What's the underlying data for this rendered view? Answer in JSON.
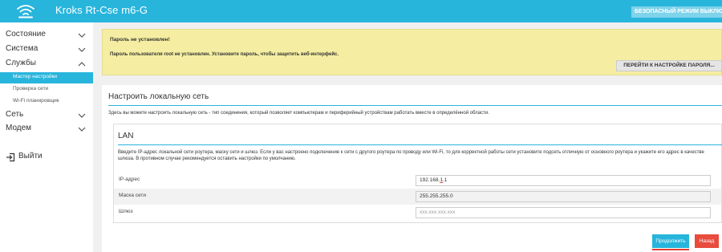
{
  "header": {
    "title": "Kroks Rt-Cse m6-G",
    "safe_mode_button": "БЕЗОПАСНЫЙ РЕЖИМ ВЫКЛЮЧЕН",
    "logo_icon": "wifi-icon",
    "accent_color": "#28b5dc"
  },
  "sidebar": {
    "items": [
      {
        "label": "Состояние",
        "icon": "chevron-down-icon"
      },
      {
        "label": "Система",
        "icon": "chevron-down-icon"
      },
      {
        "label": "Службы",
        "icon": "chevron-up-icon"
      },
      {
        "label": "Сеть",
        "icon": "chevron-down-icon"
      },
      {
        "label": "Модем",
        "icon": "chevron-down-icon"
      }
    ],
    "subitems": [
      {
        "label": "Мастер настройки",
        "active": true
      },
      {
        "label": "Проверка сети",
        "active": false
      },
      {
        "label": "Wi-Fi планировщик",
        "active": false
      }
    ],
    "logout": {
      "label": "Выйти",
      "icon": "logout-icon"
    }
  },
  "warning": {
    "title": "Пароль не установлен!",
    "text": "Пароль пользователя root не установлен. Установите пароль, чтобы защитить веб-интерфейс.",
    "button": "ПЕРЕЙТИ К НАСТРОЙКЕ ПАРОЛЯ...",
    "background_color": "#f5eea2"
  },
  "main": {
    "title": "Настроить локальную сеть",
    "description": "Здесь вы можете настроить локальную сеть - тип соединения, который позволяет компьютерам и периферийный устройствам работать вместе в определённой области.",
    "lan": {
      "title": "LAN",
      "description": "Введите IP-адрес локальной сети роутера, маску сети и шлюз. Если у вас настроено подключение к сети с другого роутера по проводу или Wi-Fi, то для корректной работы сети установите подсеть отличную от основного роутера и укажите его адрес в качестве шлюза. В противном случае рекомендуется оставить настройки по умолчанию.",
      "fields": [
        {
          "label": "IP-адрес",
          "value_prefix": "192.168.",
          "value_highlight": "1",
          "value_suffix": ".1"
        },
        {
          "label": "Маска сети",
          "value": "255.255.255.0"
        },
        {
          "label": "Шлюз",
          "placeholder": "xxx.xxx.xxx.xxx"
        }
      ]
    },
    "buttons": {
      "next": "Продолжить",
      "back": "Назад",
      "next_color": "#28b5dc",
      "back_color": "#e84c3d"
    }
  }
}
